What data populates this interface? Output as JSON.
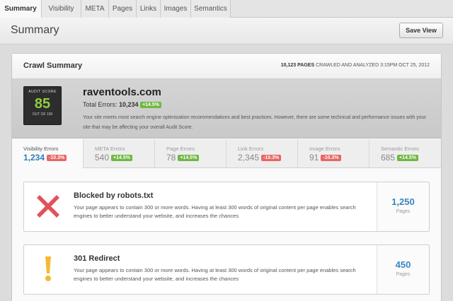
{
  "tabs": [
    "Summary",
    "Visibility",
    "META",
    "Pages",
    "Links",
    "Images",
    "Semantics"
  ],
  "header": {
    "title": "Summary",
    "save_label": "Save View"
  },
  "crawl": {
    "title": "Crawl Summary",
    "pages": "10,123 PAGES",
    "meta": "CRAWLED AND ANALYZED 3:15PM OCT 25, 2012"
  },
  "audit": {
    "label": "AUDIT SCORE",
    "score": "85",
    "out_of": "OUT OF 100",
    "site": "raventools.com",
    "total_errors_label": "Total Errors:",
    "total_errors": "10,234",
    "total_change": "+14.5%",
    "description": "Your site meets most search engine optimization recommendations and best practices. However, there are some technical and performance issues with your site that may be affecting your overall Audit Score."
  },
  "error_tabs": [
    {
      "label": "Visibility Errors",
      "value": "1,234",
      "change": "-10.3%",
      "trend": "down"
    },
    {
      "label": "META Errors",
      "value": "540",
      "change": "+14.5%",
      "trend": "up"
    },
    {
      "label": "Page Errors",
      "value": "78",
      "change": "+14.5%",
      "trend": "up"
    },
    {
      "label": "Link Errors",
      "value": "2,345",
      "change": "-10.3%",
      "trend": "down"
    },
    {
      "label": "Image Errors",
      "value": "91",
      "change": "-10.3%",
      "trend": "down"
    },
    {
      "label": "Semantic Errors",
      "value": "685",
      "change": "+14.5%",
      "trend": "up"
    }
  ],
  "cards": [
    {
      "icon": "x-icon",
      "title": "Blocked by robots.txt",
      "text": "Your page appears to contain 300 or more words. Having at least 300 words of original content per page enables search engines to better understand your website, and increases the chances",
      "count": "1,250",
      "unit": "Pages"
    },
    {
      "icon": "exclamation-icon",
      "title": "301 Redirect",
      "text": "Your page appears to contain 300 or more words. Having at least 300 words of original content per page enables search engines to better understand your website, and increases the chances",
      "count": "450",
      "unit": "Pages"
    }
  ],
  "colors": {
    "accent": "#3587bf",
    "positive": "#6fb742",
    "negative": "#e76565",
    "score": "#8fcf3f",
    "error_x": "#e2525a",
    "warning": "#f5b935"
  }
}
